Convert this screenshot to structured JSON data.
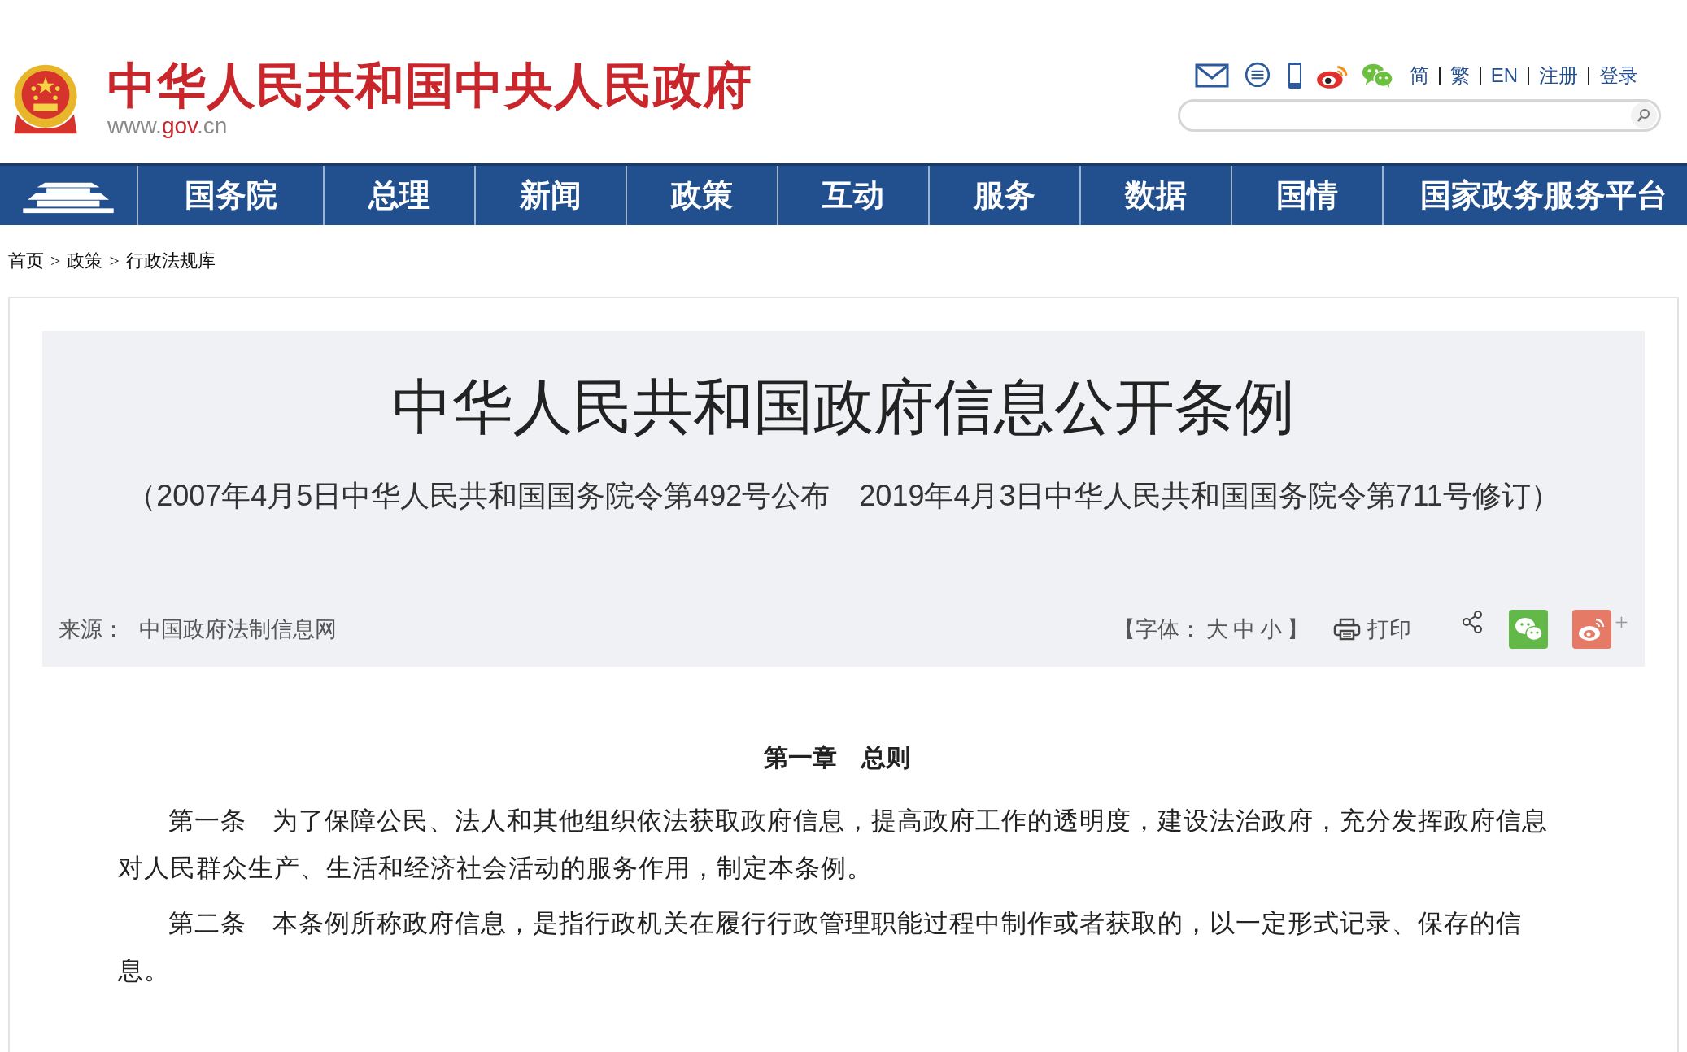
{
  "header": {
    "site_title": "中华人民共和国中央人民政府",
    "site_url_prefix": "www.",
    "site_url_domain": "gov",
    "site_url_suffix": ".cn",
    "links": [
      {
        "label": "简"
      },
      {
        "label": "繁"
      },
      {
        "label": "EN"
      },
      {
        "label": "注册"
      },
      {
        "label": "登录"
      }
    ]
  },
  "nav": {
    "items": [
      {
        "label": "国务院"
      },
      {
        "label": "总理"
      },
      {
        "label": "新闻"
      },
      {
        "label": "政策"
      },
      {
        "label": "互动"
      },
      {
        "label": "服务"
      },
      {
        "label": "数据"
      },
      {
        "label": "国情"
      },
      {
        "label": "国家政务服务平台"
      }
    ]
  },
  "breadcrumb": {
    "separator": ">",
    "items": [
      "首页",
      "政策",
      "行政法规库"
    ]
  },
  "article": {
    "title": "中华人民共和国政府信息公开条例",
    "subtitle": "（2007年4月5日中华人民共和国国务院令第492号公布　2019年4月3日中华人民共和国国务院令第711号修订）",
    "source_label": "来源：",
    "source": "中国政府法制信息网",
    "font_size_open": "【字体：",
    "font_size_options": [
      "大",
      "中",
      "小"
    ],
    "font_size_close": "】",
    "print_label": "打印",
    "share_more": "+",
    "chapter": "第一章　总则",
    "paragraphs": [
      "第一条　为了保障公民、法人和其他组织依法获取政府信息，提高政府工作的透明度，建设法治政府，充分发挥政府信息对人民群众生产、生活和经济社会活动的服务作用，制定本条例。",
      "第二条　本条例所称政府信息，是指行政机关在履行行政管理职能过程中制作或者获取的，以一定形式记录、保存的信息。"
    ]
  }
}
